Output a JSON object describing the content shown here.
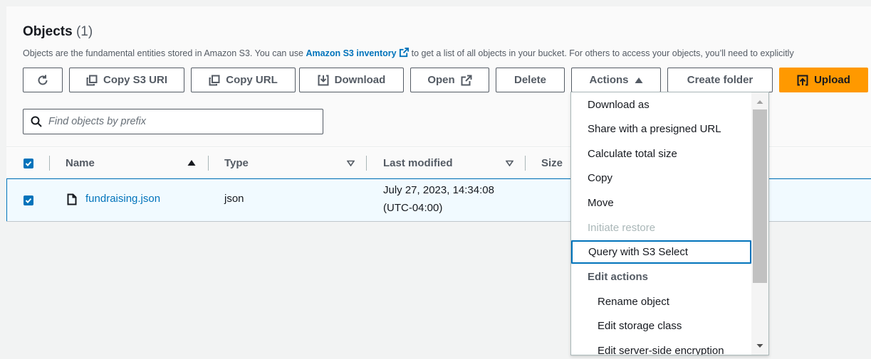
{
  "objects": {
    "title": "Objects",
    "count": "(1)",
    "description_prefix": "Objects are the fundamental entities stored in Amazon S3. You can use",
    "inventory_link": "Amazon S3 inventory",
    "description_suffix": "to get a list of all objects in your bucket. For others to access your objects, you’ll need to explicitly"
  },
  "toolbar": {
    "refresh_icon": "refresh-icon",
    "copy_s3_uri": "Copy S3 URI",
    "copy_url": "Copy URL",
    "download": "Download",
    "open": "Open",
    "delete": "Delete",
    "actions": "Actions",
    "create_folder": "Create folder",
    "upload": "Upload"
  },
  "search": {
    "placeholder": "Find objects by prefix",
    "value": ""
  },
  "table": {
    "columns": {
      "name": "Name",
      "type": "Type",
      "last_modified": "Last modified",
      "size": "Size"
    },
    "rows": [
      {
        "name": "fundraising.json",
        "type": "json",
        "last_modified_line1": "July 27, 2023, 14:34:08",
        "last_modified_line2": "(UTC-04:00)",
        "selected": true
      }
    ]
  },
  "actions_menu": {
    "items": [
      {
        "label": "Download as",
        "state": "enabled"
      },
      {
        "label": "Share with a presigned URL",
        "state": "enabled"
      },
      {
        "label": "Calculate total size",
        "state": "enabled"
      },
      {
        "label": "Copy",
        "state": "enabled"
      },
      {
        "label": "Move",
        "state": "enabled"
      },
      {
        "label": "Initiate restore",
        "state": "disabled"
      },
      {
        "label": "Query with S3 Select",
        "state": "highlighted"
      },
      {
        "label": "Edit actions",
        "state": "group-header"
      },
      {
        "label": "Rename object",
        "state": "enabled"
      },
      {
        "label": "Edit storage class",
        "state": "enabled"
      },
      {
        "label": "Edit server-side encryption",
        "state": "enabled"
      }
    ]
  },
  "colors": {
    "accent": "#0073bb",
    "primary_button": "#ff9900",
    "text": "#16191f",
    "muted": "#545b64"
  }
}
